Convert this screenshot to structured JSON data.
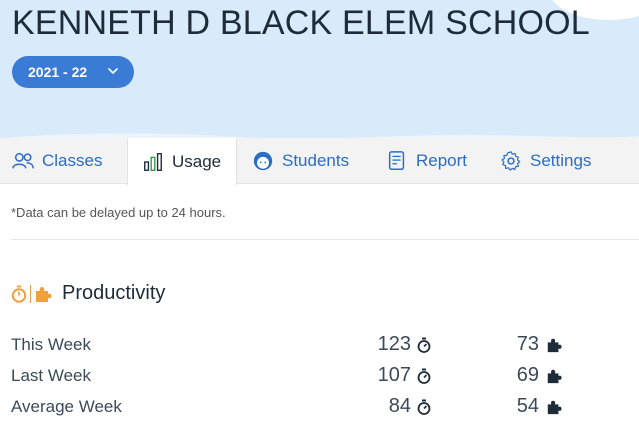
{
  "school": {
    "name": "KENNETH D BLACK ELEM SCHOOL"
  },
  "year_selector": {
    "value": "2021 - 22"
  },
  "tabs": [
    {
      "label": "Classes",
      "icon": "users-icon"
    },
    {
      "label": "Usage",
      "icon": "bar-chart-icon"
    },
    {
      "label": "Students",
      "icon": "student-face-icon"
    },
    {
      "label": "Report",
      "icon": "report-icon"
    },
    {
      "label": "Settings",
      "icon": "gear-icon"
    }
  ],
  "active_tab": "Usage",
  "note": "*Data can be delayed up to 24 hours.",
  "productivity": {
    "title": "Productivity",
    "rows": [
      {
        "label": "This Week",
        "time": "123",
        "puzzles": "73"
      },
      {
        "label": "Last Week",
        "time": "107",
        "puzzles": "69"
      },
      {
        "label": "Average Week",
        "time": "84",
        "puzzles": "54"
      }
    ]
  },
  "colors": {
    "accent": "#3a7bd5",
    "header_bg": "#d9eafb",
    "productivity_orange": "#f0a040"
  }
}
